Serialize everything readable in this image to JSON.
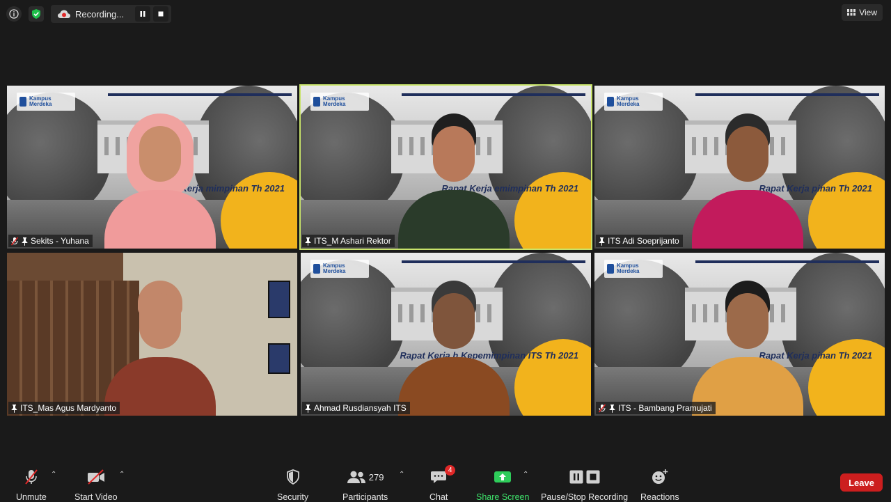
{
  "top_bar": {
    "recording_label": "Recording...",
    "view_label": "View"
  },
  "participants_grid": [
    {
      "name": "Sekits - Yuhana",
      "muted": true,
      "active_speaker": false,
      "bg_rapat": "Rapat Kerja\nmimpinan\nTh 2021"
    },
    {
      "name": "ITS_M Ashari Rektor",
      "muted": false,
      "active_speaker": true,
      "bg_rapat": "Rapat Kerja\nemimpinan\nTh 2021"
    },
    {
      "name": "ITS Adi Soeprijanto",
      "muted": false,
      "active_speaker": false,
      "bg_rapat": "Rapat Kerja\npinan\nTh 2021"
    },
    {
      "name": "ITS_Mas Agus Mardyanto",
      "muted": false,
      "active_speaker": false,
      "bg_rapat": ""
    },
    {
      "name": "Ahmad Rusdiansyah ITS",
      "muted": false,
      "active_speaker": false,
      "bg_rapat": "Rapat Kerja\nh Kepemimpinan\nITS Th 2021"
    },
    {
      "name": "ITS - Bambang Pramujati",
      "muted": true,
      "active_speaker": false,
      "bg_rapat": "Rapat Kerja\npinan\nTh 2021"
    }
  ],
  "background_logo_text": "Kampus Merdeka",
  "toolbar": {
    "unmute_label": "Unmute",
    "start_video_label": "Start Video",
    "security_label": "Security",
    "participants_label": "Participants",
    "participants_count": "279",
    "chat_label": "Chat",
    "chat_badge": "4",
    "share_screen_label": "Share Screen",
    "pause_stop_label": "Pause/Stop Recording",
    "reactions_label": "Reactions",
    "leave_label": "Leave"
  },
  "colors": {
    "active_speaker_border": "#c8e36a",
    "share_green": "#3ee26b",
    "leave_red": "#cc1e1e",
    "badge_red": "#e02828"
  }
}
